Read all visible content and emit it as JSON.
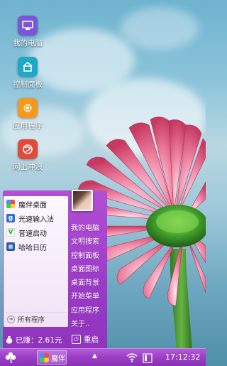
{
  "desktop": {
    "icons": [
      {
        "label": "我的电脑",
        "icon": "computer-icon",
        "color": "#7a55d8"
      },
      {
        "label": "控制面板",
        "icon": "control-panel-icon",
        "color": "#1ea8c8"
      },
      {
        "label": "应用程序",
        "icon": "apps-gear-icon",
        "color": "#f39a1e"
      },
      {
        "label": "网上冲浪",
        "icon": "browser-globe-icon",
        "color": "#e04a3a"
      }
    ]
  },
  "start_menu": {
    "apps": [
      {
        "label": "魔伴桌面",
        "icon": "mobang-desktop-icon"
      },
      {
        "label": "光速输入法",
        "icon": "input-method-icon"
      },
      {
        "label": "音速启动",
        "icon": "quick-launch-icon"
      },
      {
        "label": "哈哈日历",
        "icon": "calendar-icon"
      }
    ],
    "all_programs": "所有程序",
    "right_items": [
      "我的电脑",
      "文明搜索",
      "控制面板",
      "桌面图标",
      "桌面背景",
      "开始菜单",
      "应用程序",
      "关于.."
    ],
    "earned": "已赚：2.61元",
    "restart": "重启"
  },
  "taskbar": {
    "task_label": "魔伴",
    "clock": "17:12:32"
  },
  "colors": {
    "menu_purple": "#9b3bc6",
    "taskbar_purple": "#9a3fc4"
  }
}
